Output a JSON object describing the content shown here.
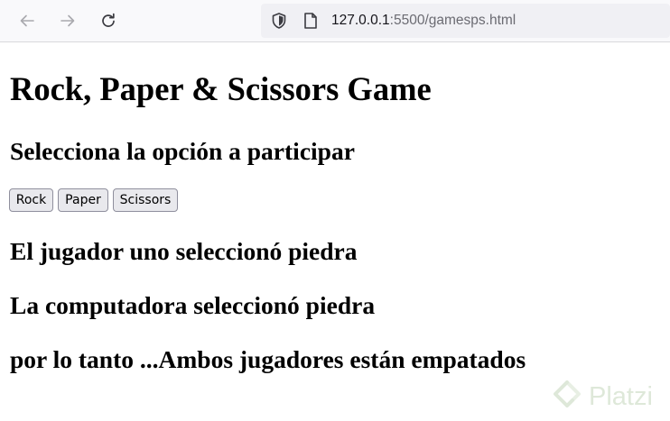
{
  "browser": {
    "url_host": "127.0.0.1",
    "url_rest": ":5500/gamesps.html",
    "icons": [
      "back-arrow-icon",
      "forward-arrow-icon",
      "reload-icon",
      "shield-icon",
      "page-icon"
    ]
  },
  "page": {
    "title": "Rock, Paper & Scissors Game",
    "subtitle": "Selecciona la opción a participar",
    "buttons": {
      "rock": "Rock",
      "paper": "Paper",
      "scissors": "Scissors"
    },
    "player_choice": "El jugador uno seleccionó piedra",
    "computer_choice": "La computadora seleccionó piedra",
    "result": "por lo tanto ...Ambos jugadores están empatados"
  },
  "watermark": {
    "text": "Platzi",
    "color": "#6c9b55"
  }
}
